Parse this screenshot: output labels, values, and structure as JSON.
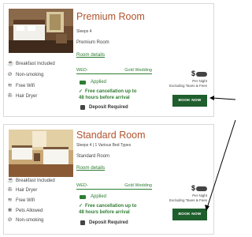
{
  "rooms": [
    {
      "title": "Premium Room",
      "sleeps": "Sleeps 4",
      "name": "Premium Room",
      "details_link": "Room details",
      "amenities": [
        {
          "icon": "breakfast-icon",
          "label": "Breakfast Included"
        },
        {
          "icon": "no-smoking-icon",
          "label": "Non-smoking"
        },
        {
          "icon": "wifi-icon",
          "label": "Free Wifi"
        },
        {
          "icon": "hair-dryer-icon",
          "label": "Hair Dryer"
        }
      ],
      "rate_code": "WED-",
      "rate_name": "Gold Wedding",
      "applied": "Applied",
      "free_cancellation": "Free cancellation up to 48 hours before arrival",
      "deposit": "Deposit Required",
      "price": "$",
      "per_night": "Per Night",
      "excluding": "Excluding Taxes & Fees",
      "book_label": "BOOK NOW"
    },
    {
      "title": "Standard Room",
      "sleeps": "Sleeps 4  |  1 Various Bed Types",
      "name": "Standard Room",
      "details_link": "Room details",
      "amenities": [
        {
          "icon": "breakfast-icon",
          "label": "Breakfast Included"
        },
        {
          "icon": "hair-dryer-icon",
          "label": "Hair Dryer"
        },
        {
          "icon": "wifi-icon",
          "label": "Free Wifi"
        },
        {
          "icon": "pets-icon",
          "label": "Pets Allowed"
        },
        {
          "icon": "no-smoking-icon",
          "label": "Non-smoking"
        }
      ],
      "rate_code": "WED-",
      "rate_name": "Gold Wedding",
      "applied": "Applied",
      "free_cancellation": "Free cancellation up to 48 hours before arrival",
      "deposit": "Deposit Required",
      "price": "$",
      "per_night": "Per Night",
      "excluding": "Excluding Taxes & Fees",
      "book_label": "BOOK NOW"
    }
  ],
  "colors": {
    "title": "#b0532c",
    "green": "#2e7d32",
    "button": "#1f5e2d"
  }
}
